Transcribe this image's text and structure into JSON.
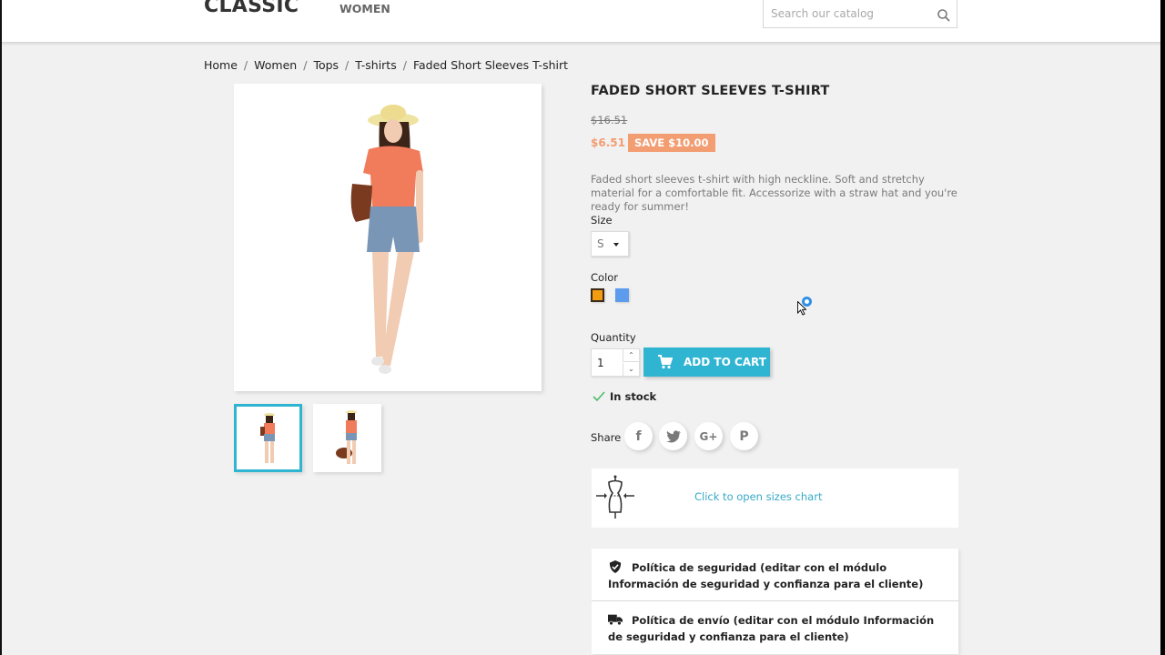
{
  "header": {
    "logo": "CLASSIC",
    "nav": [
      {
        "label": "WOMEN"
      }
    ],
    "search": {
      "placeholder": "Search our catalog",
      "value": "",
      "icon": "search-icon"
    }
  },
  "breadcrumb": [
    "Home",
    "Women",
    "Tops",
    "T-shirts",
    "Faded Short Sleeves T-shirt"
  ],
  "gallery": {
    "main_image_alt": "Woman wearing faded orange short sleeves t-shirt and denim shorts with straw hat and brown bag",
    "thumbnails": [
      {
        "alt": "Front view thumbnail",
        "selected": true
      },
      {
        "alt": "Pose with bag thumbnail",
        "selected": false
      }
    ]
  },
  "product": {
    "title": "FADED SHORT SLEEVES T-SHIRT",
    "regular_price": "$16.51",
    "price": "$6.51",
    "discount": "SAVE $10.00",
    "description": "Faded short sleeves t-shirt with high neckline. Soft and stretchy material for a comfortable fit. Accessorize with a straw hat and you're ready for summer!",
    "size_label": "Size",
    "size_value": "S",
    "color_label": "Color",
    "colors": [
      {
        "name": "Orange",
        "hex": "#f39c11",
        "selected": true
      },
      {
        "name": "Blue",
        "hex": "#5d9cec",
        "selected": false
      }
    ],
    "quantity_label": "Quantity",
    "quantity": "1",
    "add_to_cart": "ADD TO CART",
    "stock": "In stock",
    "share_label": "Share",
    "share": [
      "facebook",
      "twitter",
      "google-plus",
      "pinterest"
    ],
    "share_glyphs": {
      "facebook": "f",
      "twitter": "t",
      "google_plus": "G+",
      "pinterest": "P"
    }
  },
  "sizes_chart": {
    "link": "Click to open sizes chart"
  },
  "reassurance": [
    {
      "icon": "shield-check-icon",
      "text": "Política de seguridad (editar con el módulo Información de seguridad y confianza para el cliente)"
    },
    {
      "icon": "truck-icon",
      "text": "Política de envío (editar con el módulo Información de seguridad y confianza para el cliente)"
    }
  ],
  "colors": {
    "accent": "#2fb5d2",
    "price": "#f39d72",
    "background": "#f1f1f1",
    "link": "#36a9c8"
  }
}
